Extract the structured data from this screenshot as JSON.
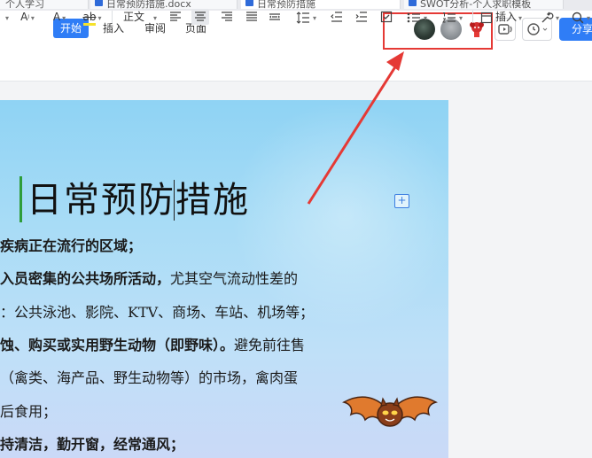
{
  "tabs": [
    {
      "label": "个人学习"
    },
    {
      "label": "日常预防措施.docx"
    },
    {
      "label": "日常预防措施"
    },
    {
      "label": "SWOT分析-个人求职模板"
    }
  ],
  "menu": {
    "tabs": [
      "开始",
      "插入",
      "审阅",
      "页面"
    ],
    "active_index": 0
  },
  "header": {
    "share_label": "分享",
    "avatar_count": 3,
    "highlight_color": "#e53935"
  },
  "toolbar": {
    "style_label": "正文",
    "insert_label": "插入"
  },
  "document": {
    "title": "日常预防措施",
    "lines": [
      "疾病正在流行的区域；",
      "入员密集的公共场所活动，尤其空气流动性差的",
      "：公共泳池、影院、KTV、商场、车站、机场等；",
      "蚀、购买或实用野生动物（即野味）。避免前往售",
      "（禽类、海产品、野生动物等）的市场，禽肉蛋",
      "后食用；",
      "持清洁，勤开窗，经常通风；"
    ]
  },
  "colors": {
    "accent": "#2f7df6",
    "annotation": "#e53935",
    "page_gradient_top": "#8fd3f4",
    "page_gradient_bottom": "#cad9f7"
  },
  "icons": [
    "font-size-icon",
    "font-color-icon",
    "highlight-icon",
    "align-left-icon",
    "align-center-icon",
    "align-right-icon",
    "justify-icon",
    "line-spacing-icon",
    "indent-decrease-icon",
    "indent-increase-icon",
    "checkbox-icon",
    "bullet-list-icon",
    "numbered-list-icon",
    "insert-icon",
    "tools-icon",
    "search-icon",
    "comment-icon",
    "read-aloud-icon",
    "history-icon",
    "bat-sticker-icon"
  ]
}
